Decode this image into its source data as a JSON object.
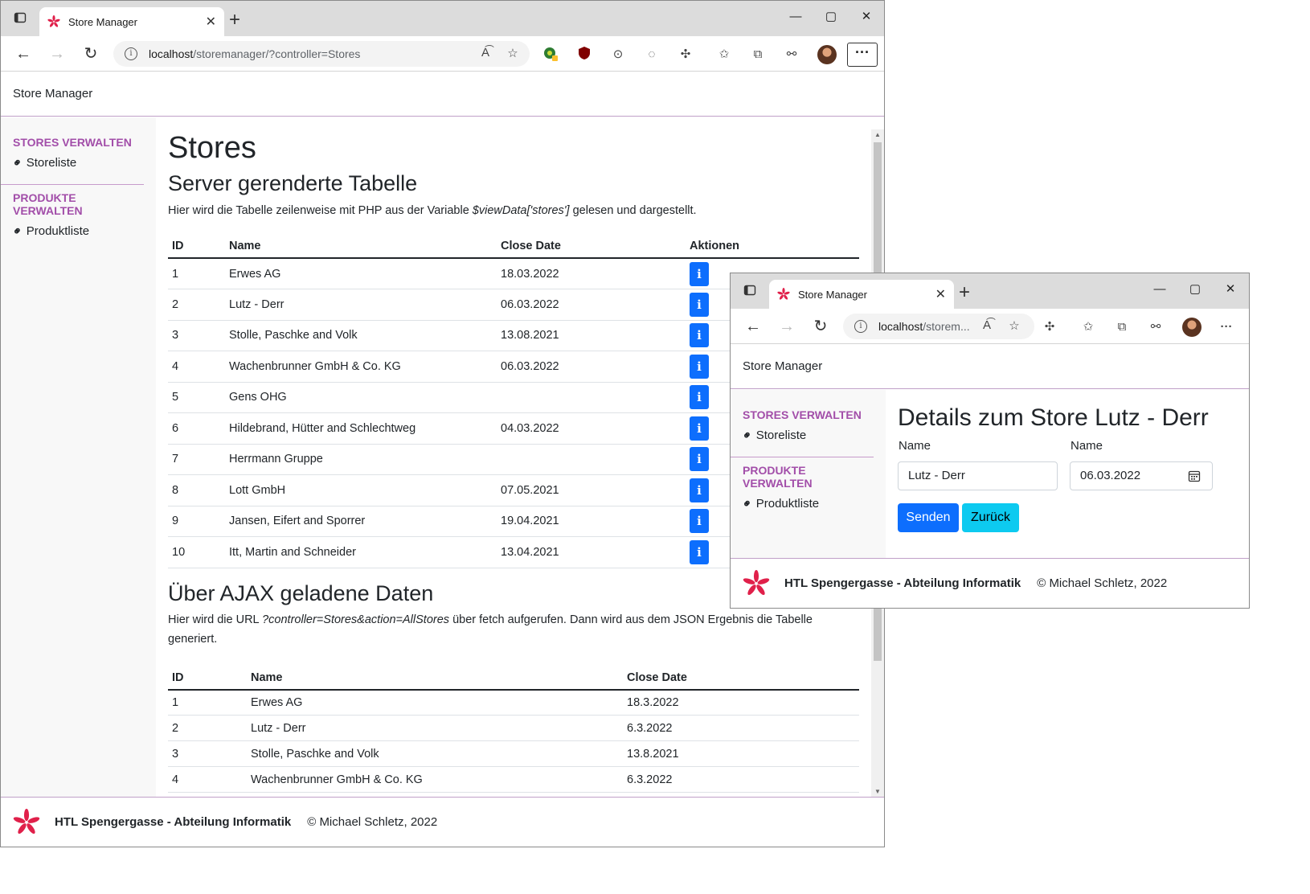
{
  "browser_main": {
    "tab_title": "Store Manager",
    "url_host": "localhost",
    "url_path": "/storemanager/?controller=Stores"
  },
  "browser_detail": {
    "tab_title": "Store Manager",
    "url_host": "localhost",
    "url_path": "/storem..."
  },
  "colors": {
    "accent_purple": "#a24ea9",
    "primary_blue": "#0d6efd",
    "info_cyan": "#0dcaf0",
    "logo_red": "#e0204a"
  },
  "navbar": {
    "brand": "Store Manager"
  },
  "sidebar": {
    "section1": "Stores verwalten",
    "link1": "Storeliste",
    "section2": "Produkte verwalten",
    "link2": "Produktliste"
  },
  "main": {
    "title": "Stores",
    "section1_heading": "Server gerenderte Tabelle",
    "section1_text_before": "Hier wird die Tabelle zeilenweise mit PHP aus der Variable ",
    "section1_text_var": "$viewData['stores']",
    "section1_text_after": " gelesen und dargestellt.",
    "table1": {
      "headers": [
        "ID",
        "Name",
        "Close Date",
        "Aktionen"
      ],
      "rows": [
        {
          "id": "1",
          "name": "Erwes AG",
          "date": "18.03.2022"
        },
        {
          "id": "2",
          "name": "Lutz - Derr",
          "date": "06.03.2022"
        },
        {
          "id": "3",
          "name": "Stolle, Paschke and Volk",
          "date": "13.08.2021"
        },
        {
          "id": "4",
          "name": "Wachenbrunner GmbH & Co. KG",
          "date": "06.03.2022"
        },
        {
          "id": "5",
          "name": "Gens OHG",
          "date": ""
        },
        {
          "id": "6",
          "name": "Hildebrand, Hütter and Schlechtweg",
          "date": "04.03.2022"
        },
        {
          "id": "7",
          "name": "Herrmann Gruppe",
          "date": ""
        },
        {
          "id": "8",
          "name": "Lott GmbH",
          "date": "07.05.2021"
        },
        {
          "id": "9",
          "name": "Jansen, Eifert and Sporrer",
          "date": "19.04.2021"
        },
        {
          "id": "10",
          "name": "Itt, Martin and Schneider",
          "date": "13.04.2021"
        }
      ]
    },
    "section2_heading": "Über AJAX geladene Daten",
    "section2_text_before": "Hier wird die URL ",
    "section2_text_url": "?controller=Stores&action=AllStores",
    "section2_text_after": " über fetch aufgerufen. Dann wird aus dem JSON Ergebnis die Tabelle generiert.",
    "table2": {
      "headers": [
        "ID",
        "Name",
        "Close Date"
      ],
      "rows": [
        {
          "id": "1",
          "name": "Erwes AG",
          "date": "18.3.2022"
        },
        {
          "id": "2",
          "name": "Lutz - Derr",
          "date": "6.3.2022"
        },
        {
          "id": "3",
          "name": "Stolle, Paschke and Volk",
          "date": "13.8.2021"
        },
        {
          "id": "4",
          "name": "Wachenbrunner GmbH & Co. KG",
          "date": "6.3.2022"
        }
      ]
    }
  },
  "footer": {
    "institution": "HTL Spengergasse - Abteilung Informatik",
    "copyright": "© Michael Schletz, 2022"
  },
  "detail": {
    "title": "Details zum Store Lutz - Derr",
    "label_name": "Name",
    "label_date": "Name",
    "name_value": "Lutz - Derr",
    "date_value": "06.03.2022",
    "submit_label": "Senden",
    "back_label": "Zurück"
  }
}
